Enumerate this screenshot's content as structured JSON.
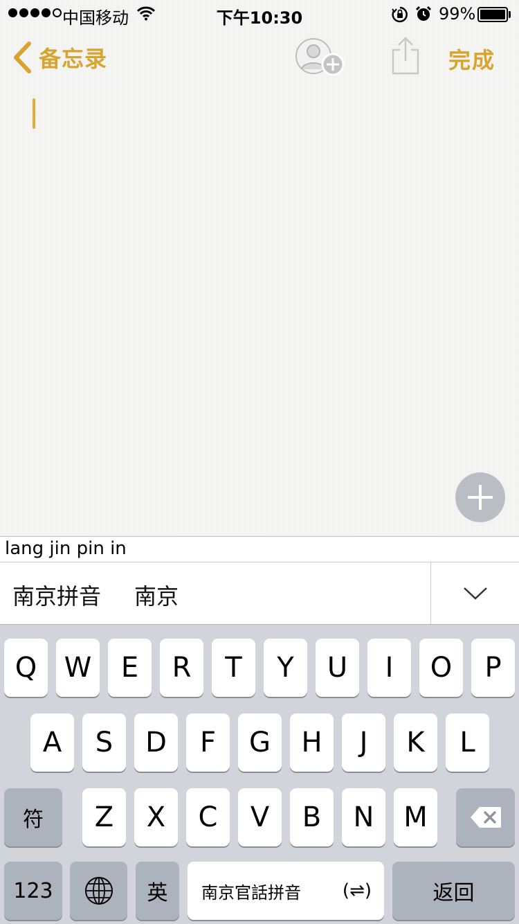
{
  "status_bar": {
    "carrier": "中国移动",
    "time": "下午10:30",
    "battery": "99%",
    "signal_bars_filled": 4,
    "signal_bars_total": 5
  },
  "nav": {
    "back_label": "备忘录",
    "done_label": "完成",
    "accent_color": "#d8a32e"
  },
  "ime": {
    "pinyin": "lang jin pin in",
    "candidates": [
      "南京拼音",
      "南京"
    ]
  },
  "keyboard": {
    "row1": [
      "Q",
      "W",
      "E",
      "R",
      "T",
      "Y",
      "U",
      "I",
      "O",
      "P"
    ],
    "row2": [
      "A",
      "S",
      "D",
      "F",
      "G",
      "H",
      "J",
      "K",
      "L"
    ],
    "row3": [
      "Z",
      "X",
      "C",
      "V",
      "B",
      "N",
      "M"
    ],
    "symbol_key": "符",
    "numbers_key": "123",
    "english_key": "英",
    "space_label": "南京官話拼音",
    "space_arrow": "(⇌)",
    "return_key": "返回"
  }
}
